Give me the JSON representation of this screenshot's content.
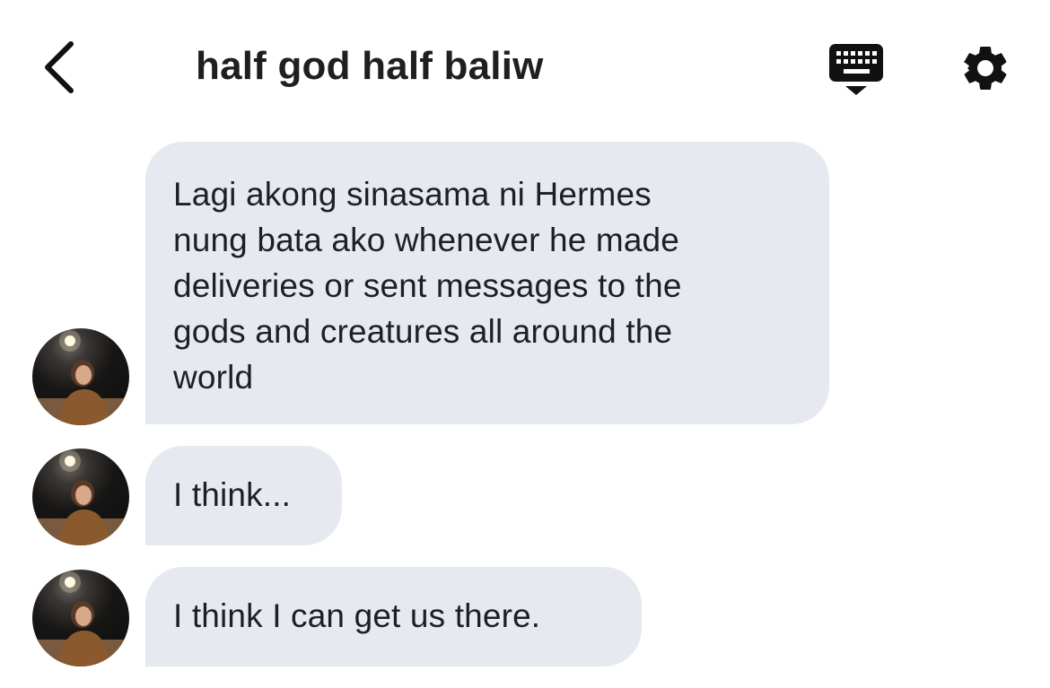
{
  "header": {
    "title": "half god half baliw",
    "back_icon": "chevron-left-icon",
    "keyboard_icon": "keyboard-icon",
    "settings_icon": "gear-icon"
  },
  "messages": [
    {
      "text": "Lagi akong sinasama ni Hermes\nnung bata ako whenever he made\ndeliveries or sent messages to the\ngods and creatures all around the\nworld",
      "has_avatar": true
    },
    {
      "text": "I think...",
      "has_avatar": true
    },
    {
      "text": "I think I can get us there.",
      "has_avatar": true
    }
  ],
  "colors": {
    "bubble_bg": "#e6eaf0",
    "text": "#1e1f22",
    "icon": "#111111"
  }
}
